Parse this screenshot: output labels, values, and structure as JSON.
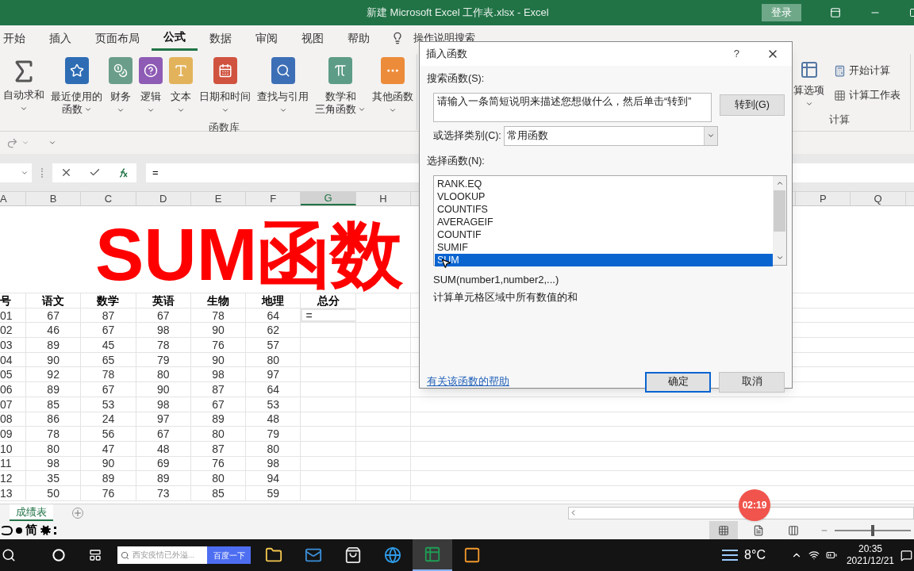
{
  "window": {
    "title": "新建 Microsoft Excel 工作表.xlsx  -  Excel",
    "sign_in": "登录"
  },
  "ribbon_tabs": [
    {
      "label": "开始",
      "selected": false
    },
    {
      "label": "插入",
      "selected": false
    },
    {
      "label": "页面布局",
      "selected": false
    },
    {
      "label": "公式",
      "selected": true
    },
    {
      "label": "数据",
      "selected": false
    },
    {
      "label": "审阅",
      "selected": false
    },
    {
      "label": "视图",
      "selected": false
    },
    {
      "label": "帮助",
      "selected": false
    }
  ],
  "tell_me": "操作说明搜索",
  "ribbon": {
    "function_library": {
      "label": "函数库",
      "buttons": [
        {
          "lines": [
            "自动求和"
          ]
        },
        {
          "lines": [
            "最近使用的",
            "函数"
          ]
        },
        {
          "lines": [
            "财务"
          ]
        },
        {
          "lines": [
            "逻辑"
          ]
        },
        {
          "lines": [
            "文本"
          ]
        },
        {
          "lines": [
            "日期和时间"
          ]
        },
        {
          "lines": [
            "查找与引用"
          ]
        },
        {
          "lines": [
            "数学和",
            "三角函数"
          ]
        },
        {
          "lines": [
            "其他函数"
          ]
        }
      ]
    },
    "calculation": {
      "label": "计算",
      "options_label": "算选项",
      "buttons": [
        "开始计算",
        "计算工作表"
      ]
    }
  },
  "formula_bar": {
    "formula": "="
  },
  "sheet": {
    "columns_left": [
      {
        "label": "A",
        "selected": false
      },
      {
        "label": "B",
        "selected": false
      },
      {
        "label": "C",
        "selected": false
      },
      {
        "label": "D",
        "selected": false
      },
      {
        "label": "E",
        "selected": false
      },
      {
        "label": "F",
        "selected": false
      },
      {
        "label": "G",
        "selected": true
      },
      {
        "label": "H",
        "selected": false
      }
    ],
    "columns_right": [
      {
        "label": "P",
        "selected": false
      },
      {
        "label": "Q",
        "selected": false
      }
    ],
    "title": "SUM函数",
    "header": [
      "号",
      "语文",
      "数学",
      "英语",
      "生物",
      "地理",
      "总分"
    ],
    "active_cell": {
      "value": "="
    },
    "rows": [
      [
        "01",
        "67",
        "87",
        "67",
        "78",
        "64"
      ],
      [
        "02",
        "46",
        "67",
        "98",
        "90",
        "62"
      ],
      [
        "03",
        "89",
        "45",
        "78",
        "76",
        "57"
      ],
      [
        "04",
        "90",
        "65",
        "79",
        "90",
        "80"
      ],
      [
        "05",
        "92",
        "78",
        "80",
        "98",
        "97"
      ],
      [
        "06",
        "89",
        "67",
        "90",
        "87",
        "64"
      ],
      [
        "07",
        "85",
        "53",
        "98",
        "67",
        "53"
      ],
      [
        "08",
        "86",
        "24",
        "97",
        "89",
        "48"
      ],
      [
        "09",
        "78",
        "56",
        "67",
        "80",
        "79"
      ],
      [
        "10",
        "80",
        "47",
        "48",
        "87",
        "80"
      ],
      [
        "11",
        "98",
        "90",
        "69",
        "76",
        "98"
      ],
      [
        "12",
        "35",
        "89",
        "89",
        "80",
        "94"
      ],
      [
        "13",
        "50",
        "76",
        "73",
        "85",
        "59"
      ]
    ]
  },
  "sheet_tabs": [
    {
      "label": "成绩表",
      "selected": true
    }
  ],
  "status_bar": {
    "ime": "简",
    "views": [
      {
        "selected": true
      },
      {
        "selected": false
      },
      {
        "selected": false
      }
    ],
    "zoom": {
      "level": 0.5
    }
  },
  "recording_timer": "02:19",
  "dialog": {
    "title": "插入函数",
    "help": "?",
    "search_label": "搜索函数(S):",
    "search_value": "请输入一条简短说明来描述您想做什么，然后单击“转到”",
    "go_button": "转到(G)",
    "category_label": "或选择类别(C):",
    "category_value": "常用函数",
    "list_label": "选择函数(N):",
    "functions": [
      {
        "label": "RANK.EQ",
        "selected": false
      },
      {
        "label": "VLOOKUP",
        "selected": false
      },
      {
        "label": "COUNTIFS",
        "selected": false
      },
      {
        "label": "AVERAGEIF",
        "selected": false
      },
      {
        "label": "COUNTIF",
        "selected": false
      },
      {
        "label": "SUMIF",
        "selected": false
      },
      {
        "label": "SUM",
        "selected": true
      }
    ],
    "signature": "SUM(number1,number2,...)",
    "description": "计算单元格区域中所有数值的和",
    "help_link": "有关该函数的帮助",
    "ok": "确定",
    "cancel": "取消"
  },
  "taskbar": {
    "search_placeholder": "西安疫情已外溢...",
    "search_button": "百度一下",
    "apps": [
      {
        "selected": false
      },
      {
        "selected": false
      },
      {
        "selected": false
      },
      {
        "selected": false
      },
      {
        "selected": true
      },
      {
        "selected": false
      }
    ],
    "temperature": "8°C",
    "time": "20:35",
    "date": "2021/12/21"
  }
}
